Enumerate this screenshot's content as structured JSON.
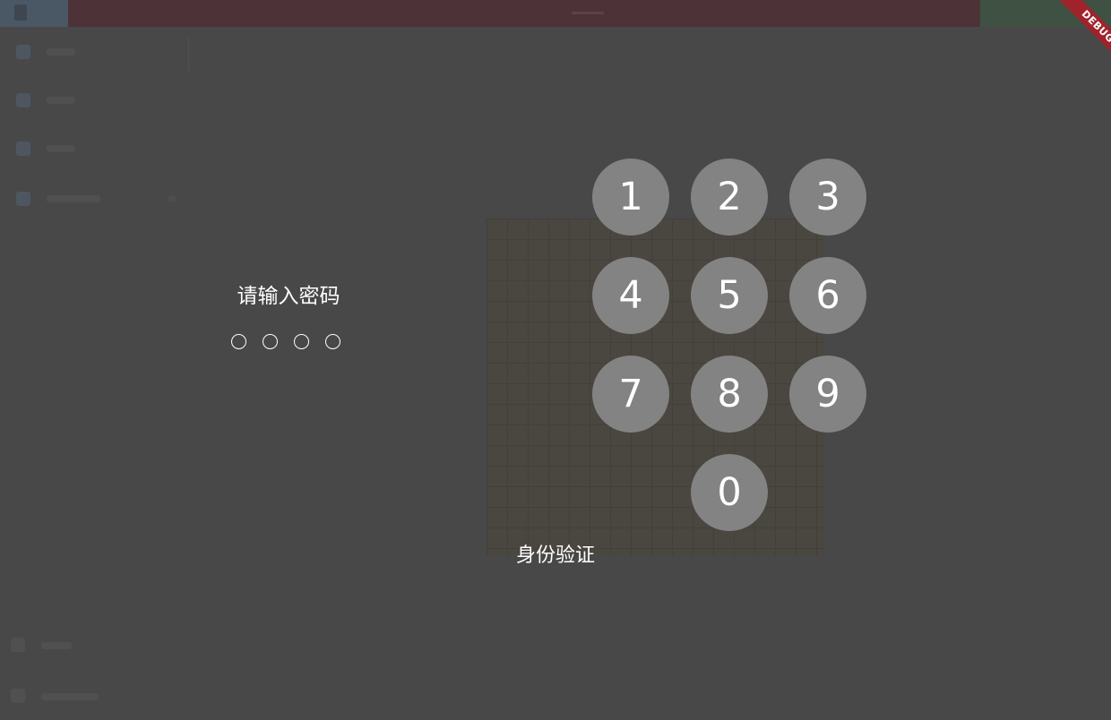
{
  "lock_screen": {
    "prompt": "请输入密码",
    "pin_length": 4,
    "entered_digits": 0,
    "keypad": [
      "1",
      "2",
      "3",
      "4",
      "5",
      "6",
      "7",
      "8",
      "9",
      "0"
    ],
    "title": "身份验证"
  },
  "debug_banner": "DEBUG",
  "colors": {
    "overlay_background": "#484848",
    "key_fill": "#838383",
    "text": "#ffffff",
    "debug_banner": "#a0232b"
  }
}
